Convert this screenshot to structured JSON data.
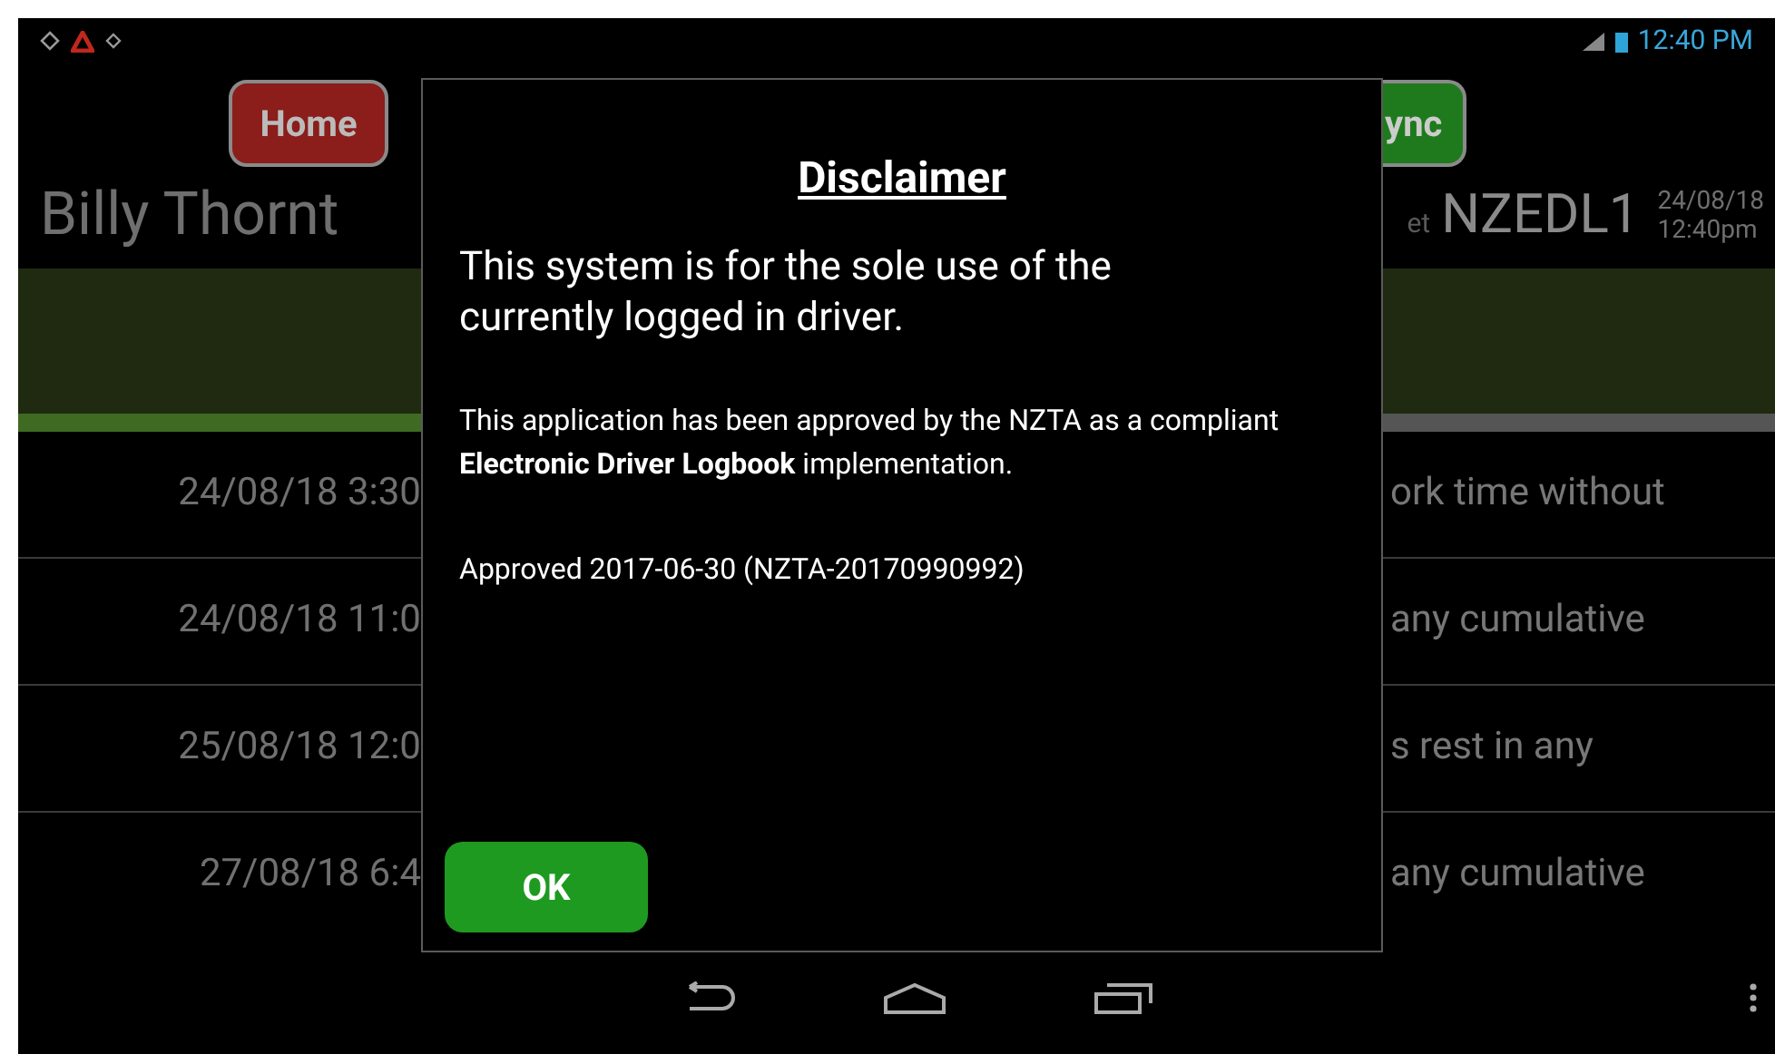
{
  "status_bar": {
    "time": "12:40 PM"
  },
  "nav_buttons": [
    {
      "label": "Home",
      "color": "#8b1d1a"
    },
    {
      "label": "ync",
      "color": "#1e7a1c"
    }
  ],
  "driver": {
    "name": "Billy Thornt"
  },
  "ruleset": {
    "label": "et",
    "value": "NZEDL1"
  },
  "datetime": {
    "date": "24/08/18",
    "time": "12:40pm"
  },
  "progress": {
    "level": 0.45
  },
  "rules": [
    {
      "time": "24/08/18 3:30",
      "text": "ork time without"
    },
    {
      "time": "24/08/18 11:0",
      "text": "any cumulative"
    },
    {
      "time": "25/08/18 12:0",
      "text": "s rest in any"
    },
    {
      "time": "27/08/18 6:4",
      "text": "any cumulative"
    }
  ],
  "dialog": {
    "title": "Disclaimer",
    "lead": "This system is for the sole use of the currently logged in driver.",
    "body": "This application has been approved by the NZTA as a compliant **Electronic Driver Logbook** implementation.",
    "approval": "Approved 2017-06-30 (NZTA-20170990992)",
    "button": "OK"
  }
}
